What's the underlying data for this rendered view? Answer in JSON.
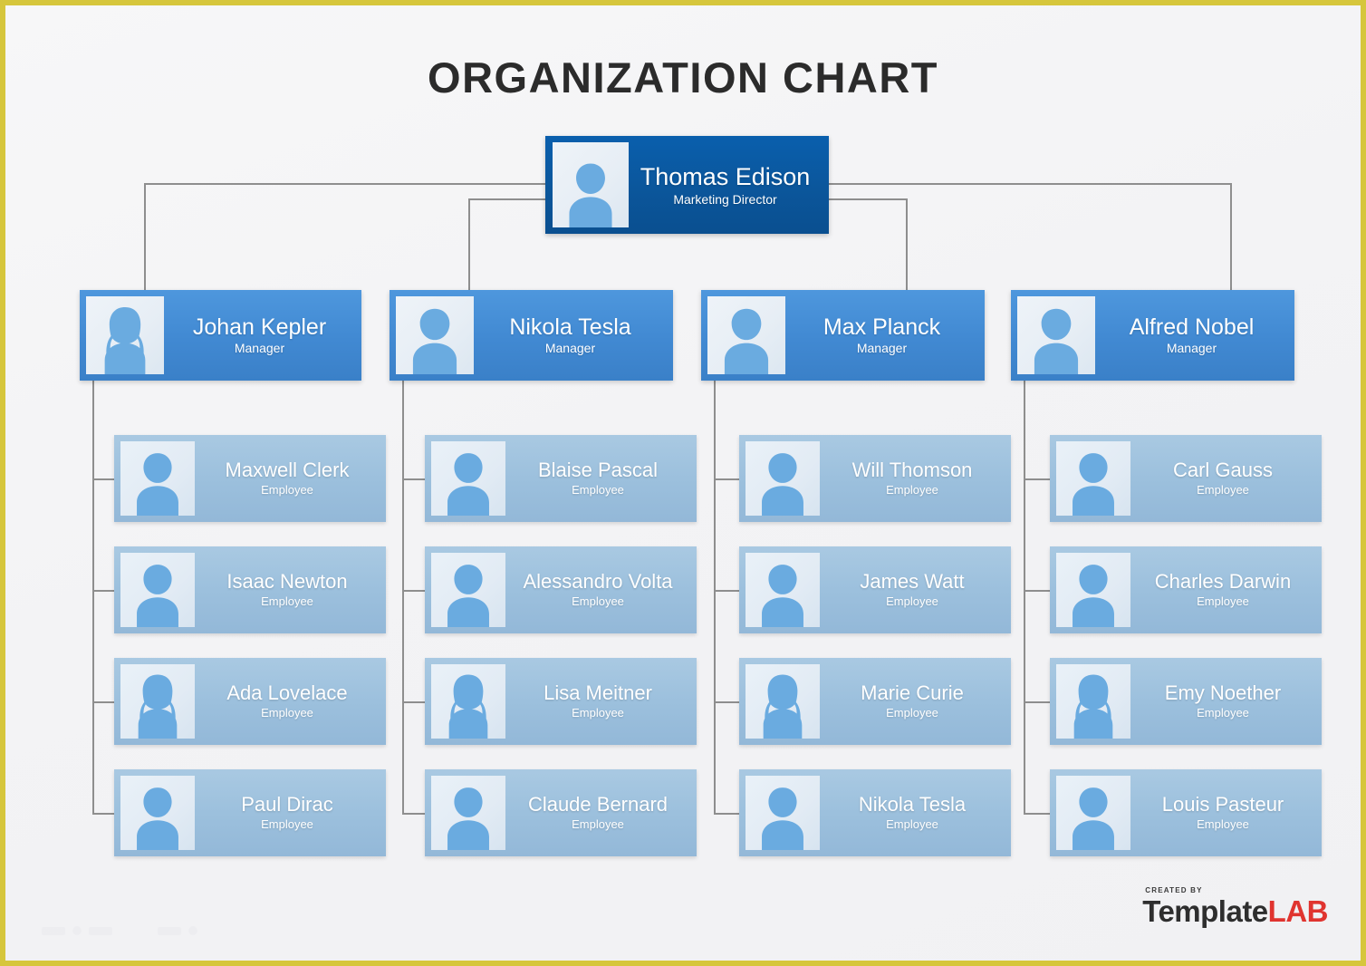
{
  "title": "ORGANIZATION CHART",
  "colors": {
    "frame_border": "#d6c63c",
    "background": "#f4f4f6",
    "director_box": "#0b569b",
    "manager_box": "#4189d2",
    "employee_box": "#9cc0dd",
    "connector_line": "#8e8e8e",
    "title_text": "#2b2b2b",
    "logo_accent": "#e0342f"
  },
  "root": {
    "name": "Thomas Edison",
    "role": "Marketing Director",
    "avatar": "person-male-icon"
  },
  "columns": [
    {
      "manager": {
        "name": "Johan Kepler",
        "role": "Manager",
        "avatar": "person-female-icon"
      },
      "employees": [
        {
          "name": "Maxwell Clerk",
          "role": "Employee",
          "avatar": "person-male-icon"
        },
        {
          "name": "Isaac Newton",
          "role": "Employee",
          "avatar": "person-male-icon"
        },
        {
          "name": "Ada Lovelace",
          "role": "Employee",
          "avatar": "person-female-icon"
        },
        {
          "name": "Paul Dirac",
          "role": "Employee",
          "avatar": "person-male-icon"
        }
      ]
    },
    {
      "manager": {
        "name": "Nikola Tesla",
        "role": "Manager",
        "avatar": "person-male-icon"
      },
      "employees": [
        {
          "name": "Blaise Pascal",
          "role": "Employee",
          "avatar": "person-male-icon"
        },
        {
          "name": "Alessandro Volta",
          "role": "Employee",
          "avatar": "person-male-icon"
        },
        {
          "name": "Lisa Meitner",
          "role": "Employee",
          "avatar": "person-female-icon"
        },
        {
          "name": "Claude Bernard",
          "role": "Employee",
          "avatar": "person-male-icon"
        }
      ]
    },
    {
      "manager": {
        "name": "Max Planck",
        "role": "Manager",
        "avatar": "person-male-icon"
      },
      "employees": [
        {
          "name": "Will Thomson",
          "role": "Employee",
          "avatar": "person-male-icon"
        },
        {
          "name": "James Watt",
          "role": "Employee",
          "avatar": "person-male-icon"
        },
        {
          "name": "Marie Curie",
          "role": "Employee",
          "avatar": "person-female-icon"
        },
        {
          "name": "Nikola Tesla",
          "role": "Employee",
          "avatar": "person-male-icon"
        }
      ]
    },
    {
      "manager": {
        "name": "Alfred Nobel",
        "role": "Manager",
        "avatar": "person-male-icon"
      },
      "employees": [
        {
          "name": "Carl Gauss",
          "role": "Employee",
          "avatar": "person-male-icon"
        },
        {
          "name": "Charles Darwin",
          "role": "Employee",
          "avatar": "person-male-icon"
        },
        {
          "name": "Emy Noether",
          "role": "Employee",
          "avatar": "person-female-icon"
        },
        {
          "name": "Louis Pasteur",
          "role": "Employee",
          "avatar": "person-male-icon"
        }
      ]
    }
  ],
  "logo": {
    "created_by": "CREATED BY",
    "word_primary": "Template",
    "word_accent": "LAB"
  },
  "chart_data": {
    "type": "diagram",
    "diagram_type": "organization-chart",
    "levels": 3,
    "nodes": [
      {
        "id": "n0",
        "name": "Thomas Edison",
        "role": "Marketing Director",
        "level": 0,
        "parent": null
      },
      {
        "id": "n1",
        "name": "Johan Kepler",
        "role": "Manager",
        "level": 1,
        "parent": "n0"
      },
      {
        "id": "n2",
        "name": "Nikola Tesla",
        "role": "Manager",
        "level": 1,
        "parent": "n0"
      },
      {
        "id": "n3",
        "name": "Max Planck",
        "role": "Manager",
        "level": 1,
        "parent": "n0"
      },
      {
        "id": "n4",
        "name": "Alfred Nobel",
        "role": "Manager",
        "level": 1,
        "parent": "n0"
      },
      {
        "id": "n1a",
        "name": "Maxwell Clerk",
        "role": "Employee",
        "level": 2,
        "parent": "n1"
      },
      {
        "id": "n1b",
        "name": "Isaac Newton",
        "role": "Employee",
        "level": 2,
        "parent": "n1"
      },
      {
        "id": "n1c",
        "name": "Ada Lovelace",
        "role": "Employee",
        "level": 2,
        "parent": "n1"
      },
      {
        "id": "n1d",
        "name": "Paul Dirac",
        "role": "Employee",
        "level": 2,
        "parent": "n1"
      },
      {
        "id": "n2a",
        "name": "Blaise Pascal",
        "role": "Employee",
        "level": 2,
        "parent": "n2"
      },
      {
        "id": "n2b",
        "name": "Alessandro Volta",
        "role": "Employee",
        "level": 2,
        "parent": "n2"
      },
      {
        "id": "n2c",
        "name": "Lisa Meitner",
        "role": "Employee",
        "level": 2,
        "parent": "n2"
      },
      {
        "id": "n2d",
        "name": "Claude Bernard",
        "role": "Employee",
        "level": 2,
        "parent": "n2"
      },
      {
        "id": "n3a",
        "name": "Will Thomson",
        "role": "Employee",
        "level": 2,
        "parent": "n3"
      },
      {
        "id": "n3b",
        "name": "James Watt",
        "role": "Employee",
        "level": 2,
        "parent": "n3"
      },
      {
        "id": "n3c",
        "name": "Marie Curie",
        "role": "Employee",
        "level": 2,
        "parent": "n3"
      },
      {
        "id": "n3d",
        "name": "Nikola Tesla",
        "role": "Employee",
        "level": 2,
        "parent": "n3"
      },
      {
        "id": "n4a",
        "name": "Carl Gauss",
        "role": "Employee",
        "level": 2,
        "parent": "n4"
      },
      {
        "id": "n4b",
        "name": "Charles Darwin",
        "role": "Employee",
        "level": 2,
        "parent": "n4"
      },
      {
        "id": "n4c",
        "name": "Emy Noether",
        "role": "Employee",
        "level": 2,
        "parent": "n4"
      },
      {
        "id": "n4d",
        "name": "Louis Pasteur",
        "role": "Employee",
        "level": 2,
        "parent": "n4"
      }
    ]
  }
}
